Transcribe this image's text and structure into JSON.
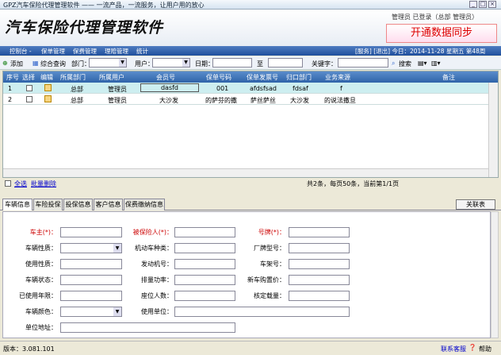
{
  "window": {
    "title": "GPZ汽车保险代理管理软件 —— 一流产品，一流服务，让用户用的放心"
  },
  "header": {
    "logo": "汽车保险代理管理软件",
    "user_info": "管理员  已登录（总部 管理员）",
    "sync_button": "开通数据同步"
  },
  "nav": {
    "items": [
      "控制台 -",
      "保单管理",
      "保费管理",
      "理赔管理",
      "统计"
    ],
    "right": "[服务]  [退出]  今日：2014-11-28  星期五  第48周"
  },
  "toolbar": {
    "add": "添加",
    "combined_query": "综合查询",
    "dept_label": "部门：",
    "user_label": "用户：",
    "date_label": "日期：",
    "to_label": "至",
    "keyword_label": "关键字：",
    "search": "搜索"
  },
  "grid": {
    "columns": [
      "序号",
      "选择",
      "编辑",
      "所属部门",
      "所属用户",
      "会员号",
      "保单号码",
      "保单发票号",
      "归口部门",
      "业务来源",
      "备注"
    ],
    "rows": [
      {
        "no": "1",
        "dept": "总部",
        "user": "管理员",
        "member": "dasfd",
        "policy": "001",
        "invoice": "afdsfsad",
        "owner_dept": "fdsaf",
        "source": "f",
        "remark": ""
      },
      {
        "no": "2",
        "dept": "总部",
        "user": "管理员",
        "member": "大沙发",
        "policy": "的萨芬的撒",
        "invoice": "萨丝萨丝",
        "owner_dept": "大沙发",
        "source": "的说法撒旦",
        "remark": ""
      }
    ],
    "select_all": "全选",
    "batch_delete": "批量删除",
    "pagination": "共2条，每页50条，当前第1/1页"
  },
  "tabs": [
    "车辆信息",
    "车险投保",
    "投保信息",
    "客户信息",
    "保费缴纳信息"
  ],
  "close_tab": "关联表",
  "form": {
    "owner": "车主(*)：",
    "insured": "被保险人(*)：",
    "plate": "号牌(*)：",
    "vehicle_type": "车辆性质：",
    "vehicle_kind": "机动车种类：",
    "brand": "厂牌型号：",
    "usage": "使用性质：",
    "engine": "发动机号：",
    "frame": "车架号：",
    "status": "车辆状态：",
    "displacement": "排量功率：",
    "new_price": "新车购置价：",
    "years": "已使用年限：",
    "seats": "座位人数：",
    "load": "核定载量：",
    "color": "车辆颜色：",
    "unit": "使用单位：",
    "address": "单位地址："
  },
  "status_bar": {
    "version": "版本：3.081.101",
    "support": "联系客服",
    "help": "帮助"
  }
}
